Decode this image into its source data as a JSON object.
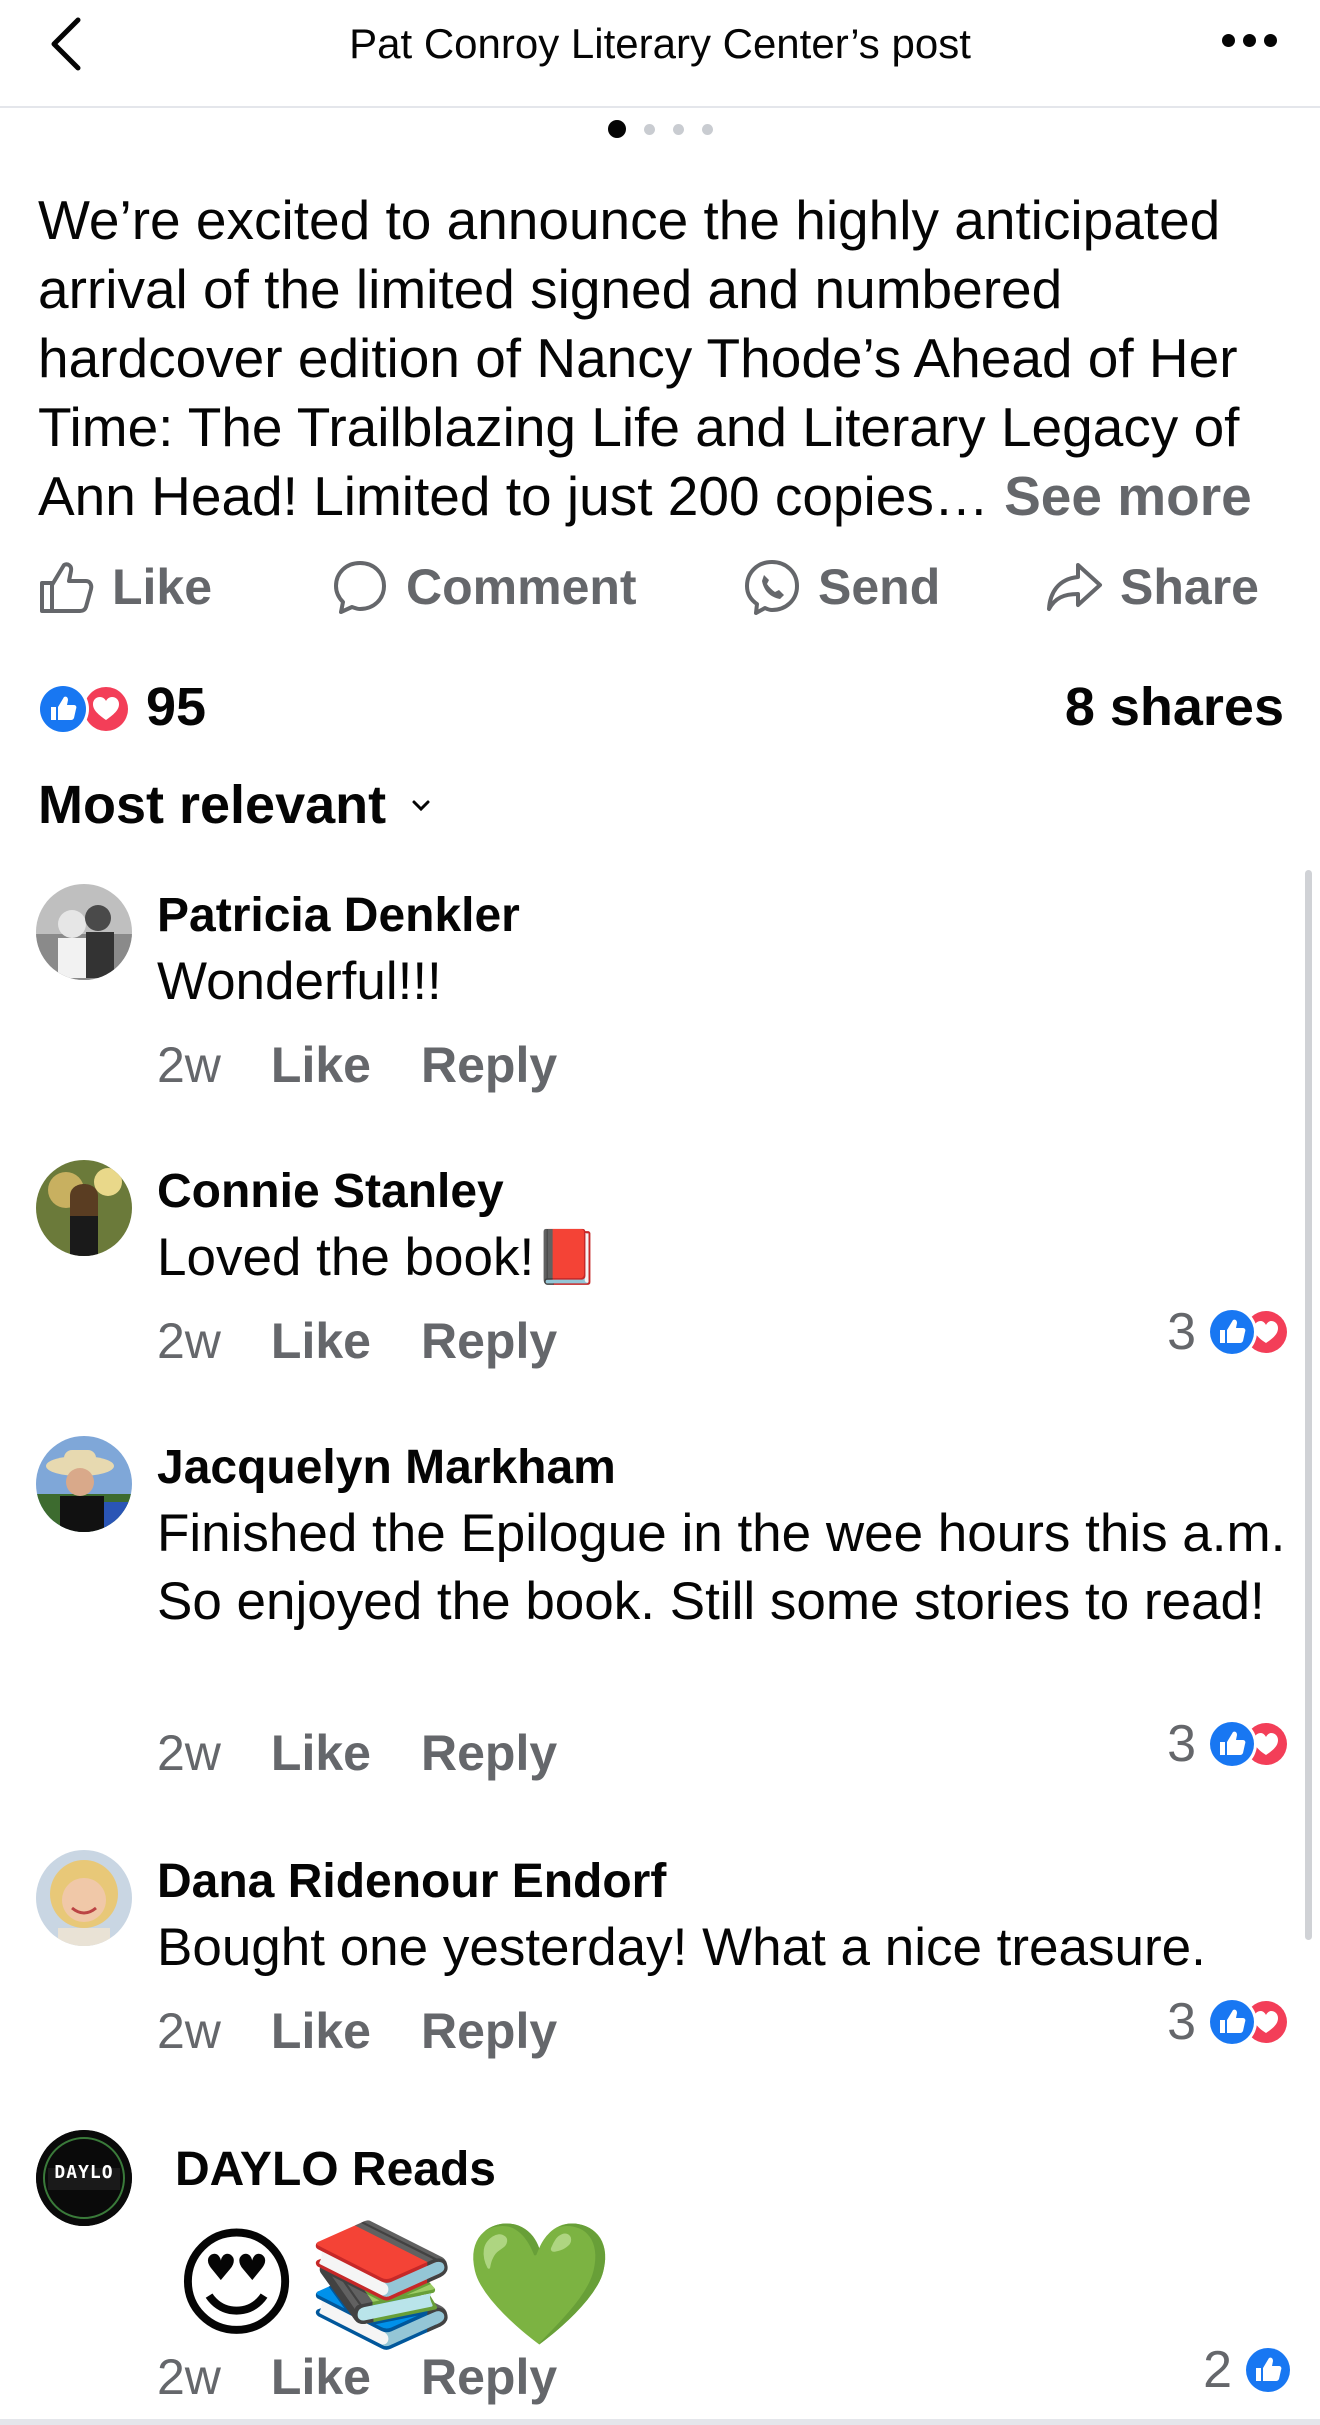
{
  "header": {
    "title": "Pat Conroy Literary Center’s post"
  },
  "carousel": {
    "total": 4,
    "active_index": 0
  },
  "post": {
    "text": "We’re excited to announce the highly anticipated arrival of the limited signed and numbered hardcover edition of Nancy Thode’s Ahead of Her Time: The Trailblazing Life and Literary Legacy of Ann Head! Limited to just 200 copies…",
    "see_more": "See more"
  },
  "actions": {
    "like": "Like",
    "comment": "Comment",
    "send": "Send",
    "share": "Share"
  },
  "summary": {
    "reaction_count": "95",
    "shares": "8 shares"
  },
  "sort": {
    "label": "Most relevant"
  },
  "comments": [
    {
      "name": "Patricia Denkler",
      "text": "Wonderful!!!",
      "time": "2w",
      "like": "Like",
      "reply": "Reply",
      "reactions": ""
    },
    {
      "name": "Connie Stanley",
      "text": "Loved the book!📕",
      "time": "2w",
      "like": "Like",
      "reply": "Reply",
      "reactions": "3"
    },
    {
      "name": "Jacquelyn Markham",
      "text": "Finished the Epilogue in the wee hours this a.m. So enjoyed the book.  Still some stories to read!",
      "time": "2w",
      "like": "Like",
      "reply": "Reply",
      "reactions": "3"
    },
    {
      "name": "Dana Ridenour Endorf",
      "text": "Bought one yesterday! What a nice treasure.",
      "time": "2w",
      "like": "Like",
      "reply": "Reply",
      "reactions": "3"
    },
    {
      "name": "DAYLO Reads",
      "text": "😍📚💚",
      "time": "2w",
      "like": "Like",
      "reply": "Reply",
      "reactions": "2",
      "avatar_text": "DAYLO"
    }
  ],
  "colors": {
    "like_blue": "#1877f2",
    "love_red": "#f33e58",
    "secondary_text": "#65676b"
  }
}
